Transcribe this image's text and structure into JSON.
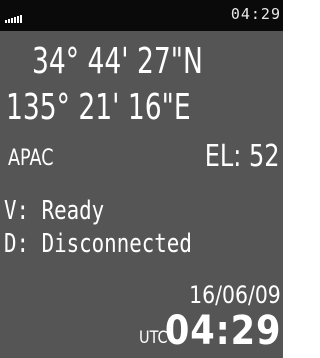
{
  "status_bar": {
    "signal_icon": "signal-strength-icon",
    "time": "04:29"
  },
  "position": {
    "latitude": "34° 44' 27\"N",
    "longitude": "135° 21' 16\"E"
  },
  "satellite": {
    "system": "APAC",
    "elevation": "EL: 52"
  },
  "status": {
    "v_status": "V: Ready",
    "d_status": "D: Disconnected"
  },
  "datetime": {
    "date": "16/06/09",
    "utc_label": "UTC",
    "time": "04:29"
  },
  "colors": {
    "screen_background": "#555555",
    "status_bar_background": "#0a0a0a",
    "text": "#ffffff"
  }
}
